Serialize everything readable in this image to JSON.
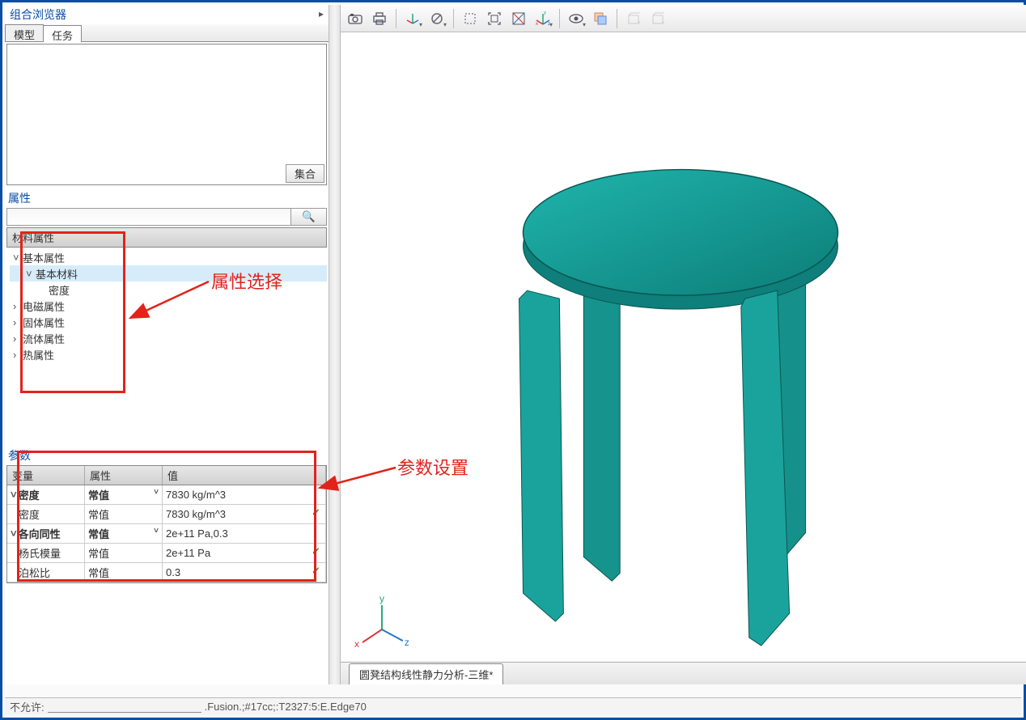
{
  "left": {
    "panel_title": "组合浏览器",
    "tab_model": "模型",
    "tab_tasks": "任务",
    "tree_footer": "集合",
    "section_properties": "属性",
    "search_placeholder": "",
    "material_props_header": "材料属性",
    "tree_items": {
      "basic_props": "基本属性",
      "basic_material": "基本材料",
      "density": "密度",
      "em_props": "电磁属性",
      "solid_props": "固体属性",
      "fluid_props": "流体属性",
      "thermal_props": "热属性"
    },
    "params_title": "参数",
    "params_headers": {
      "var": "变量",
      "attr": "属性",
      "val": "值"
    },
    "params_rows": [
      {
        "var": "密度",
        "attr": "常值",
        "val": "7830 kg/m^3",
        "bold": true,
        "caret": true,
        "dd": true,
        "check": false
      },
      {
        "var": "密度",
        "attr": "常值",
        "val": "7830 kg/m^3",
        "bold": false,
        "caret": false,
        "dd": false,
        "check": true
      },
      {
        "var": "各向同性",
        "attr": "常值",
        "val": "2e+11 Pa,0.3",
        "bold": true,
        "caret": true,
        "dd": true,
        "check": false
      },
      {
        "var": "杨氏模量",
        "attr": "常值",
        "val": "2e+11 Pa",
        "bold": false,
        "caret": false,
        "dd": false,
        "check": true
      },
      {
        "var": "泊松比",
        "attr": "常值",
        "val": "0.3",
        "bold": false,
        "caret": false,
        "dd": false,
        "check": true
      }
    ]
  },
  "annotations": {
    "prop_select": "属性选择",
    "param_set": "参数设置"
  },
  "toolbar": {
    "camera": "camera-icon",
    "print": "print-icon",
    "axis": "axis-icon",
    "forbid": "no-icon",
    "select_rect": "select-rect-icon",
    "fit": "fit-icon",
    "compass": "compass-icon",
    "xyz": "xyz-axis-icon",
    "eye": "eye-icon",
    "layers": "layers-icon",
    "box1": "box-icon",
    "box2": "box-icon"
  },
  "viewport": {
    "tab_title": "圆凳结构线性静力分析-三维*",
    "axis_labels": {
      "x": "x",
      "y": "y",
      "z": "z"
    }
  },
  "status": {
    "prefix": "不允许:",
    "detail": ".Fusion.;#17cc;:T2327:5:E.Edge70"
  },
  "icons": {
    "search": "🔍"
  }
}
